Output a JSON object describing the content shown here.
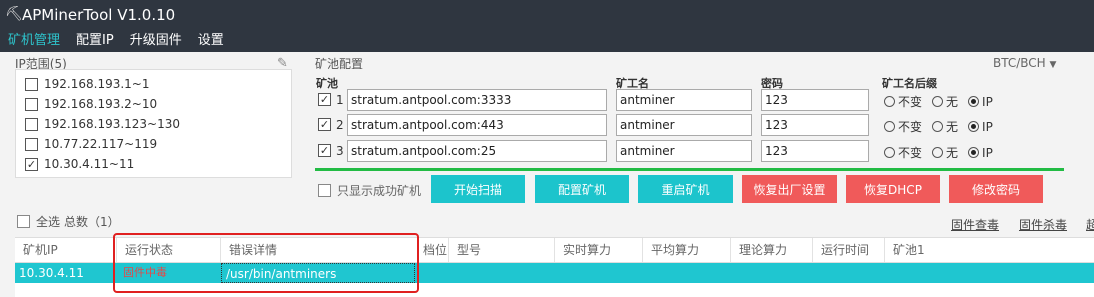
{
  "window": {
    "title": "APMinerTool V1.0.10"
  },
  "menu": [
    "矿机管理",
    "配置IP",
    "升级固件",
    "设置"
  ],
  "ip_panel": {
    "label": "IP范围(5)",
    "items": [
      {
        "label": "192.168.193.1~1",
        "checked": false
      },
      {
        "label": "192.168.193.2~10",
        "checked": false
      },
      {
        "label": "192.168.193.123~130",
        "checked": false
      },
      {
        "label": "10.77.22.117~119",
        "checked": false
      },
      {
        "label": "10.30.4.11~11",
        "checked": true
      }
    ]
  },
  "pool_panel": {
    "label": "矿池配置",
    "coin": "BTC/BCH",
    "headers": {
      "pool": "矿池",
      "worker": "矿工名",
      "password": "密码",
      "suffix": "矿工名后缀"
    },
    "rows": [
      {
        "num": "1",
        "checked": true,
        "pool": "stratum.antpool.com:3333",
        "worker": "antminer",
        "password": "123"
      },
      {
        "num": "2",
        "checked": true,
        "pool": "stratum.antpool.com:443",
        "worker": "antminer",
        "password": "123"
      },
      {
        "num": "3",
        "checked": true,
        "pool": "stratum.antpool.com:25",
        "worker": "antminer",
        "password": "123"
      }
    ],
    "suffix_options": [
      "不变",
      "无",
      "IP"
    ],
    "suffix_selected": "IP"
  },
  "actions": {
    "success_only": "只显示成功矿机",
    "scan": "开始扫描",
    "config": "配置矿机",
    "reboot": "重启矿机",
    "factory_reset": "恢复出厂设置",
    "restore_dhcp": "恢复DHCP",
    "change_password": "修改密码"
  },
  "list": {
    "select_all": "全选",
    "total": "总数（1）",
    "links": [
      "固件查毒",
      "固件杀毒",
      "超"
    ],
    "columns": [
      "矿机IP",
      "运行状态",
      "错误详情",
      "档位",
      "型号",
      "实时算力",
      "平均算力",
      "理论算力",
      "运行时间",
      "矿池1"
    ],
    "rows": [
      {
        "ip": "10.30.4.11",
        "status": "固件中毒",
        "error": "/usr/bin/antminers"
      }
    ]
  },
  "colors": {
    "accent": "#1cc4cc",
    "danger": "#f05a5a",
    "titlebar": "#2f3640",
    "highlight": "#e02020"
  }
}
